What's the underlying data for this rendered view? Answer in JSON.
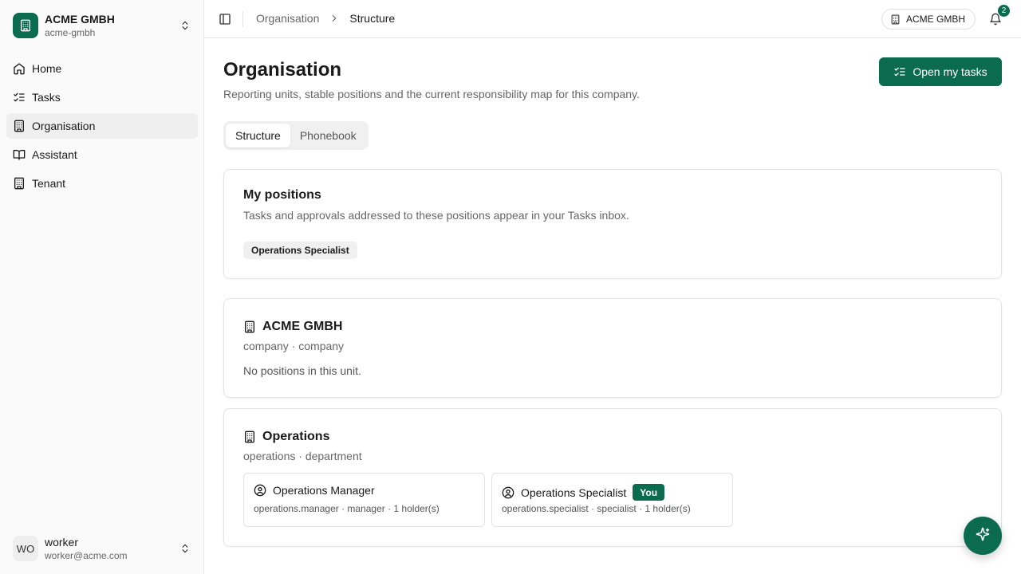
{
  "sidebar": {
    "tenant": {
      "name": "ACME GMBH",
      "slug": "acme-gmbh",
      "logo_icon": "building-icon"
    },
    "nav": [
      {
        "label": "Home",
        "icon": "home-icon",
        "active": false
      },
      {
        "label": "Tasks",
        "icon": "list-checks-icon",
        "active": false
      },
      {
        "label": "Organisation",
        "icon": "building-icon",
        "active": true
      },
      {
        "label": "Assistant",
        "icon": "book-open-icon",
        "active": false
      },
      {
        "label": "Tenant",
        "icon": "building-icon",
        "active": false
      }
    ],
    "user": {
      "initials": "WO",
      "name": "worker",
      "email": "worker@acme.com"
    }
  },
  "header": {
    "breadcrumb": {
      "parent": "Organisation",
      "current": "Structure"
    },
    "tenant_pill": "ACME GMBH",
    "notifications_count": "2"
  },
  "page": {
    "title": "Organisation",
    "subtitle": "Reporting units, stable positions and the current responsibility map for this company.",
    "primary_action": "Open my tasks",
    "tabs": [
      {
        "label": "Structure",
        "active": true
      },
      {
        "label": "Phonebook",
        "active": false
      }
    ]
  },
  "my_positions": {
    "title": "My positions",
    "description": "Tasks and approvals addressed to these positions appear in your Tasks inbox.",
    "chips": [
      "Operations Specialist"
    ]
  },
  "units": [
    {
      "name": "ACME GMBH",
      "meta": "company · company",
      "empty_text": "No positions in this unit.",
      "positions": []
    },
    {
      "name": "Operations",
      "meta": "operations · department",
      "positions": [
        {
          "title": "Operations Manager",
          "meta": "operations.manager · manager · 1 holder(s)",
          "is_you": false
        },
        {
          "title": "Operations Specialist",
          "meta": "operations.specialist · specialist · 1 holder(s)",
          "is_you": true,
          "badge": "You"
        }
      ]
    }
  ],
  "colors": {
    "brand": "#0b6b4f",
    "border": "#e3e3e3",
    "muted_text": "#666666"
  }
}
